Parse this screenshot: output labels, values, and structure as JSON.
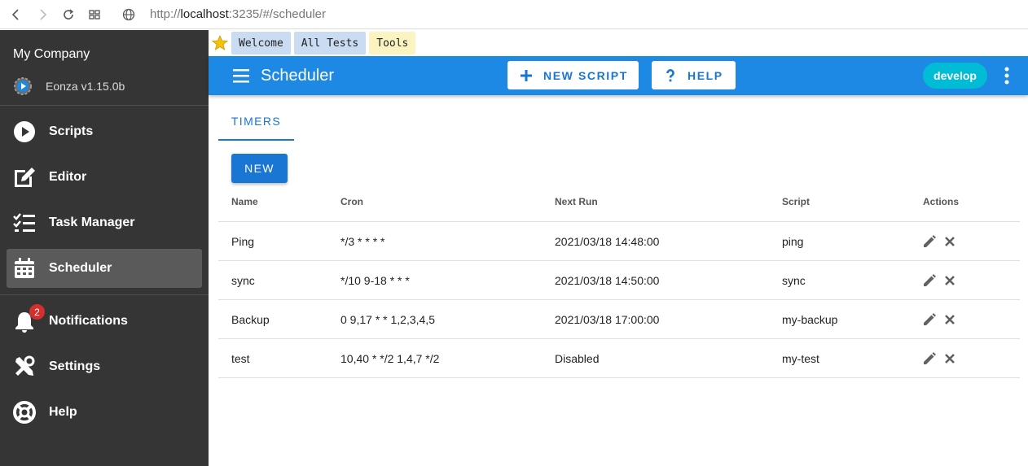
{
  "browser": {
    "url_scheme": "http://",
    "url_host": "localhost",
    "url_path": ":3235/#/scheduler"
  },
  "sidebar": {
    "company": "My Company",
    "version": "Eonza v1.15.0b",
    "items": [
      {
        "label": "Scripts",
        "icon": "play-circle-icon"
      },
      {
        "label": "Editor",
        "icon": "edit-icon"
      },
      {
        "label": "Task Manager",
        "icon": "task-list-icon"
      },
      {
        "label": "Scheduler",
        "icon": "calendar-icon",
        "active": true
      },
      {
        "label": "Notifications",
        "icon": "bell-icon",
        "badge": "2"
      },
      {
        "label": "Settings",
        "icon": "tools-icon"
      },
      {
        "label": "Help",
        "icon": "lifebuoy-icon"
      }
    ]
  },
  "bookmarks": [
    "Welcome",
    "All Tests",
    "Tools"
  ],
  "appbar": {
    "title": "Scheduler",
    "new_script_label": "NEW SCRIPT",
    "help_label": "HELP",
    "env": "develop"
  },
  "tabs": [
    "TIMERS"
  ],
  "new_button": "NEW",
  "table": {
    "headers": [
      "Name",
      "Cron",
      "Next Run",
      "Script",
      "Actions"
    ],
    "rows": [
      {
        "name": "Ping",
        "cron": "*/3 * * * *",
        "next_run": "2021/03/18 14:48:00",
        "script": "ping"
      },
      {
        "name": "sync",
        "cron": "*/10 9-18 * * *",
        "next_run": "2021/03/18 14:50:00",
        "script": "sync"
      },
      {
        "name": "Backup",
        "cron": "0 9,17 * * 1,2,3,4,5",
        "next_run": "2021/03/18 17:00:00",
        "script": "my-backup"
      },
      {
        "name": "test",
        "cron": "10,40 * */2 1,4,7 */2",
        "next_run": "Disabled",
        "script": "my-test"
      }
    ]
  },
  "colors": {
    "primary": "#1e88e5",
    "sidebar": "#353535",
    "accent_chip": "#00bcd4",
    "badge": "#d32f2f"
  }
}
